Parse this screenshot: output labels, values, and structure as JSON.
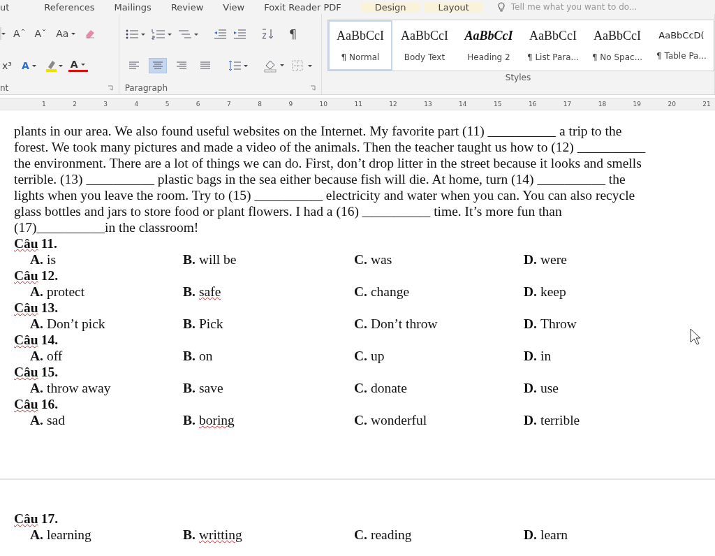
{
  "tabs": [
    {
      "label": "ut",
      "contextual": false
    },
    {
      "label": "References",
      "contextual": false
    },
    {
      "label": "Mailings",
      "contextual": false
    },
    {
      "label": "Review",
      "contextual": false
    },
    {
      "label": "View",
      "contextual": false
    },
    {
      "label": "Foxit Reader PDF",
      "contextual": false
    },
    {
      "label": "Design",
      "contextual": true
    },
    {
      "label": "Layout",
      "contextual": true
    }
  ],
  "tell_me": {
    "placeholder": "Tell me what you want to do..."
  },
  "font_group": {
    "label": "nt",
    "grow": "A",
    "shrink": "A",
    "change_case": "Aa",
    "superscript": "x³",
    "effects": "A",
    "font_color": "A"
  },
  "paragraph_group": {
    "label": "Paragraph",
    "pilcrow": "¶",
    "alignments": [
      {
        "selected": false
      },
      {
        "selected": true
      },
      {
        "selected": false
      },
      {
        "selected": false
      }
    ]
  },
  "styles_group": {
    "label": "Styles",
    "items": [
      {
        "preview": "AaBbCcI",
        "name": "¶ Normal",
        "kind": "normal",
        "selected": true
      },
      {
        "preview": "AaBbCcI",
        "name": "Body Text",
        "kind": "normal",
        "selected": false
      },
      {
        "preview": "AaBbCcI",
        "name": "Heading 2",
        "kind": "heading",
        "selected": false
      },
      {
        "preview": "AaBbCcI",
        "name": "¶ List Para...",
        "kind": "normal",
        "selected": false
      },
      {
        "preview": "AaBbCcI",
        "name": "¶ No Spac...",
        "kind": "normal",
        "selected": false
      },
      {
        "preview": "AaBbCcD(",
        "name": "¶ Table Pa...",
        "kind": "small",
        "selected": false
      }
    ]
  },
  "ruler": [
    "1",
    "2",
    "3",
    "4",
    "5",
    "6",
    "7",
    "8",
    "9",
    "10",
    "11",
    "12",
    "13",
    "14",
    "15",
    "16",
    "17",
    "18",
    "19",
    "20",
    "21"
  ],
  "passage_lines": [
    "plants in our area. We also found useful websites on the Internet. My favorite part (11) __________ a trip to the",
    "forest. We took many pictures and made a video of the animals. Then the teacher taught us how to (12) __________",
    "the environment. There are a lot of things we can do. First, don’t drop litter in the street because it looks and smells",
    "terrible. (13) __________ plastic bags in the sea either because fish will die. At home, turn (14) __________ the",
    "lights when you leave the room. Try to (15) __________ electricity and water when you can. You can also recycle",
    "glass bottles and jars to store food or plant flowers. I had a (16) __________ time. It’s more fun than",
    "(17)__________in the classroom!"
  ],
  "questions": [
    {
      "word": "Câu",
      "number": "11.",
      "page_break_before": false,
      "options": [
        {
          "letter": "A.",
          "text": "is",
          "flagged": false
        },
        {
          "letter": "B.",
          "text": "will be",
          "flagged": false
        },
        {
          "letter": "C.",
          "text": "was",
          "flagged": false
        },
        {
          "letter": "D.",
          "text": "were",
          "flagged": false
        }
      ]
    },
    {
      "word": "Câu",
      "number": "12.",
      "page_break_before": false,
      "options": [
        {
          "letter": "A.",
          "text": "protect",
          "flagged": false
        },
        {
          "letter": "B.",
          "text": "safe",
          "flagged": true
        },
        {
          "letter": "C.",
          "text": "change",
          "flagged": false
        },
        {
          "letter": "D.",
          "text": "keep",
          "flagged": false
        }
      ]
    },
    {
      "word": "Câu",
      "number": "13.",
      "page_break_before": false,
      "options": [
        {
          "letter": "A.",
          "text": "Don’t pick",
          "flagged": false
        },
        {
          "letter": "B.",
          "text": "Pick",
          "flagged": false
        },
        {
          "letter": "C.",
          "text": "Don’t throw",
          "flagged": false
        },
        {
          "letter": "D.",
          "text": "Throw",
          "flagged": false
        }
      ]
    },
    {
      "word": "Câu",
      "number": "14.",
      "page_break_before": false,
      "options": [
        {
          "letter": "A.",
          "text": "off",
          "flagged": false
        },
        {
          "letter": "B.",
          "text": "on",
          "flagged": false
        },
        {
          "letter": "C.",
          "text": "up",
          "flagged": false
        },
        {
          "letter": "D.",
          "text": "in",
          "flagged": false
        }
      ]
    },
    {
      "word": "Câu",
      "number": "15.",
      "page_break_before": false,
      "options": [
        {
          "letter": "A.",
          "text": "throw away",
          "flagged": false
        },
        {
          "letter": "B.",
          "text": "save",
          "flagged": false
        },
        {
          "letter": "C.",
          "text": "donate",
          "flagged": false
        },
        {
          "letter": "D.",
          "text": "use",
          "flagged": false
        }
      ]
    },
    {
      "word": "Câu",
      "number": "16.",
      "page_break_before": false,
      "options": [
        {
          "letter": "A.",
          "text": "sad",
          "flagged": false
        },
        {
          "letter": "B.",
          "text": "boring",
          "flagged": true
        },
        {
          "letter": "C.",
          "text": "wonderful",
          "flagged": false
        },
        {
          "letter": "D.",
          "text": "terrible",
          "flagged": false
        }
      ]
    },
    {
      "word": "Câu",
      "number": "17.",
      "page_break_before": true,
      "options": [
        {
          "letter": "A.",
          "text": "learning",
          "flagged": false
        },
        {
          "letter": "B.",
          "text": "writting",
          "flagged": true
        },
        {
          "letter": "C.",
          "text": "reading",
          "flagged": false
        },
        {
          "letter": "D.",
          "text": "learn",
          "flagged": false
        }
      ]
    }
  ]
}
